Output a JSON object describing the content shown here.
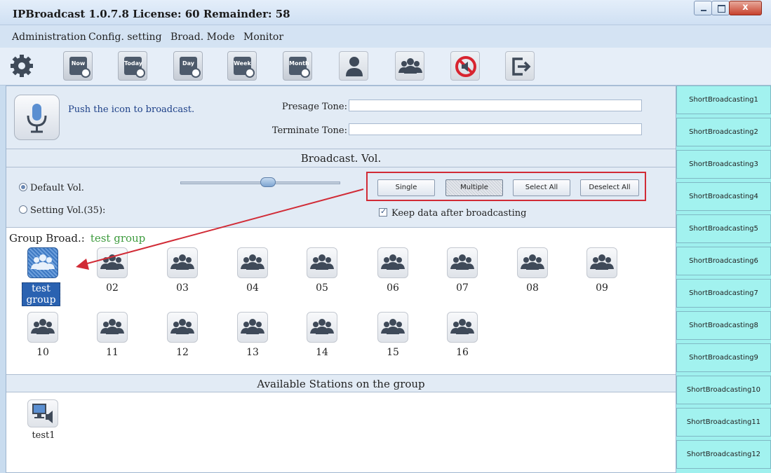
{
  "window": {
    "title": "IPBroadcast 1.0.7.8 License: 60 Remainder: 58",
    "close_glyph": "x"
  },
  "menu": [
    "Administration",
    "Config. setting",
    "Broad. Mode",
    "Monitor"
  ],
  "toolbar": {
    "tools": [
      {
        "icon": "settings-gear-icon"
      },
      {
        "icon": "calendar-now-icon",
        "label": "Now"
      },
      {
        "icon": "calendar-today-icon",
        "label": "Today"
      },
      {
        "icon": "calendar-day-icon",
        "label": "Day"
      },
      {
        "icon": "calendar-week-icon",
        "label": "Week"
      },
      {
        "icon": "calendar-month-icon",
        "label": "Month"
      },
      {
        "icon": "user-icon"
      },
      {
        "icon": "user-group-icon"
      },
      {
        "icon": "mute-speaker-icon"
      },
      {
        "icon": "exit-icon"
      }
    ]
  },
  "voice": {
    "hint": "Push the icon to broadcast.",
    "presage_label": "Presage Tone:",
    "presage_value": "",
    "terminate_label": "Terminate Tone:",
    "terminate_value": ""
  },
  "volume": {
    "header": "Broadcast. Vol.",
    "default_label": "Default Vol.",
    "setting_label": "Setting Vol.(35):",
    "default_selected": true,
    "slider_level": 0.55
  },
  "selection": {
    "single": "Single",
    "multiple": "Multiple",
    "select_all": "Select All",
    "deselect_all": "Deselect All",
    "active_mode": "Multiple",
    "keep_data_label": "Keep data after broadcasting",
    "keep_data_checked": true
  },
  "groups": {
    "label": "Group Broad.:",
    "current": "test group",
    "items": [
      "test group",
      "02",
      "03",
      "04",
      "05",
      "06",
      "07",
      "08",
      "09",
      "10",
      "11",
      "12",
      "13",
      "14",
      "15",
      "16"
    ],
    "selected_index": 0
  },
  "stations": {
    "header": "Available Stations on the group",
    "items": [
      "test1"
    ]
  },
  "short_broadcasts": [
    "ShortBroadcasting1",
    "ShortBroadcasting2",
    "ShortBroadcasting3",
    "ShortBroadcasting4",
    "ShortBroadcasting5",
    "ShortBroadcasting6",
    "ShortBroadcasting7",
    "ShortBroadcasting8",
    "ShortBroadcasting9",
    "ShortBroadcasting10",
    "ShortBroadcasting11",
    "ShortBroadcasting12"
  ],
  "colors": {
    "accent_red": "#d12b36",
    "group_name_green": "#3d9b3d",
    "short_button_cyan": "#a2f2ef",
    "selection_blue": "#2a62b1"
  }
}
